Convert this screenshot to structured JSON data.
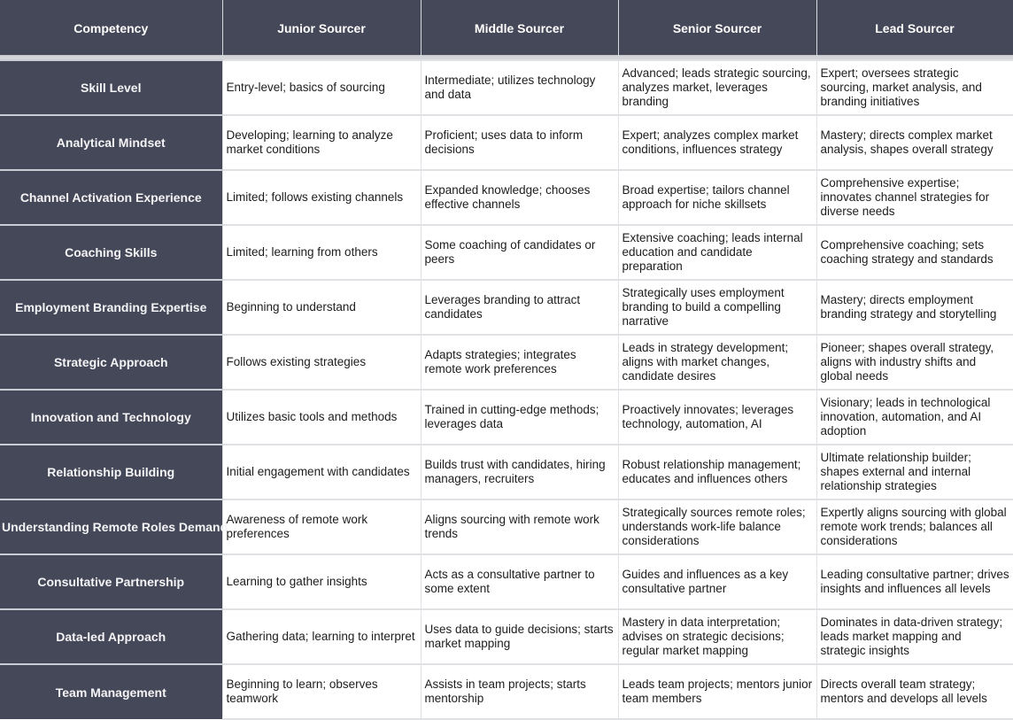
{
  "table": {
    "headers": [
      "Competency",
      "Junior Sourcer",
      "Middle Sourcer",
      "Senior Sourcer",
      "Lead Sourcer"
    ],
    "rows": [
      {
        "competency": "Skill Level",
        "junior": "Entry-level; basics of sourcing",
        "middle": "Intermediate; utilizes technology and data",
        "senior": "Advanced; leads strategic sourcing, analyzes market, leverages branding",
        "lead": "Expert; oversees strategic sourcing, market analysis, and branding initiatives"
      },
      {
        "competency": "Analytical Mindset",
        "junior": "Developing; learning to analyze market conditions",
        "middle": "Proficient; uses data to inform decisions",
        "senior": "Expert; analyzes complex market conditions, influences strategy",
        "lead": "Mastery; directs complex market analysis, shapes overall strategy"
      },
      {
        "competency": "Channel Activation Experience",
        "junior": "Limited; follows existing channels",
        "middle": "Expanded knowledge; chooses effective channels",
        "senior": "Broad expertise; tailors channel approach for niche skillsets",
        "lead": "Comprehensive expertise; innovates channel strategies for diverse needs"
      },
      {
        "competency": "Coaching Skills",
        "junior": "Limited; learning from others",
        "middle": "Some coaching of candidates or peers",
        "senior": "Extensive coaching; leads internal education and candidate preparation",
        "lead": "Comprehensive coaching; sets coaching strategy and standards"
      },
      {
        "competency": "Employment Branding Expertise",
        "junior": "Beginning to understand",
        "middle": "Leverages branding to attract candidates",
        "senior": "Strategically uses employment branding to build a compelling narrative",
        "lead": "Mastery; directs employment branding strategy and storytelling"
      },
      {
        "competency": "Strategic Approach",
        "junior": "Follows existing strategies",
        "middle": "Adapts strategies; integrates remote work preferences",
        "senior": "Leads in strategy development; aligns with market changes, candidate desires",
        "lead": "Pioneer; shapes overall strategy, aligns with industry shifts and global needs"
      },
      {
        "competency": "Innovation and Technology",
        "junior": "Utilizes basic tools and methods",
        "middle": "Trained in cutting-edge methods; leverages data",
        "senior": "Proactively innovates; leverages technology, automation, AI",
        "lead": "Visionary; leads in technological innovation, automation, and AI adoption"
      },
      {
        "competency": "Relationship Building",
        "junior": "Initial engagement with candidates",
        "middle": "Builds trust with candidates, hiring managers, recruiters",
        "senior": "Robust relationship management; educates and influences others",
        "lead": "Ultimate relationship builder; shapes external and internal relationship strategies"
      },
      {
        "competency": "Understanding Remote Roles Demand",
        "junior": "Awareness of remote work preferences",
        "middle": "Aligns sourcing with remote work trends",
        "senior": "Strategically sources remote roles; understands work-life balance considerations",
        "lead": "Expertly aligns sourcing with global remote work trends; balances all considerations"
      },
      {
        "competency": "Consultative Partnership",
        "junior": "Learning to gather insights",
        "middle": "Acts as a consultative partner to some extent",
        "senior": "Guides and influences as a key consultative partner",
        "lead": "Leading consultative partner; drives insights and influences all levels"
      },
      {
        "competency": "Data-led Approach",
        "junior": "Gathering data; learning to interpret",
        "middle": "Uses data to guide decisions; starts market mapping",
        "senior": "Mastery in data interpretation; advises on strategic decisions; regular market mapping",
        "lead": "Dominates in data-driven strategy; leads market mapping and strategic insights"
      },
      {
        "competency": "Team Management",
        "junior": "Beginning to learn; observes teamwork",
        "middle": "Assists in team projects; starts mentorship",
        "senior": "Leads team projects; mentors junior team members",
        "lead": "Directs overall team strategy; mentors and develops all levels"
      }
    ]
  },
  "colors": {
    "header_bg": "#454858",
    "header_text": "#ffffff",
    "cell_bg": "#ffffff",
    "cell_text": "#1d1d1f",
    "grid": "#dfe1e4"
  }
}
